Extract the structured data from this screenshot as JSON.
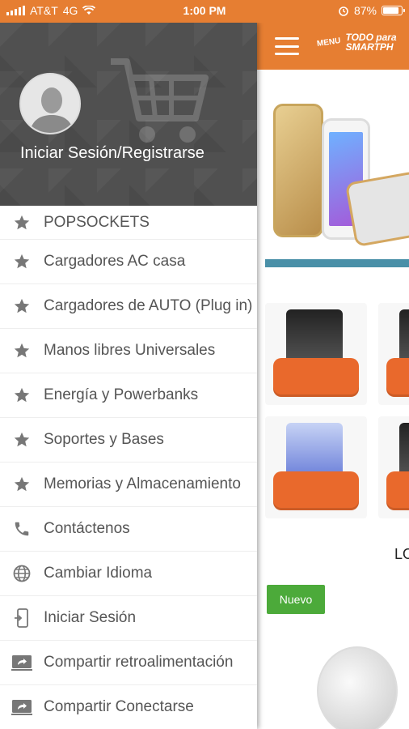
{
  "status_bar": {
    "carrier": "AT&T",
    "network": "4G",
    "time": "1:00 PM",
    "battery": "87%"
  },
  "drawer": {
    "header": {
      "login_label": "Iniciar Sesión/Registrarse"
    },
    "items": [
      {
        "label": "POPSOCKETS",
        "icon": "star-icon"
      },
      {
        "label": "Cargadores AC casa",
        "icon": "star-icon"
      },
      {
        "label": "Cargadores de AUTO (Plug in)",
        "icon": "star-icon"
      },
      {
        "label": "Manos libres Universales",
        "icon": "star-icon"
      },
      {
        "label": "Energía y Powerbanks",
        "icon": "star-icon"
      },
      {
        "label": "Soportes y Bases",
        "icon": "star-icon"
      },
      {
        "label": "Memorias y Almacenamiento",
        "icon": "star-icon"
      },
      {
        "label": "Contáctenos",
        "icon": "phone-icon"
      },
      {
        "label": "Cambiar Idioma",
        "icon": "globe-icon"
      },
      {
        "label": "Iniciar Sesión",
        "icon": "mobile-login-icon"
      },
      {
        "label": "Compartir retroalimentación",
        "icon": "share-screen-icon"
      },
      {
        "label": "Compartir Conectarse",
        "icon": "share-screen-icon"
      }
    ]
  },
  "app": {
    "toolbar": {
      "menu_text": "MENU",
      "logo_line1": "TODO para",
      "logo_line2": "SMARTPH"
    },
    "section_partial_text": "LO",
    "badge_label": "Nuevo"
  },
  "colors": {
    "accent_orange": "#e67e32",
    "button_orange": "#e9692c",
    "badge_green": "#4caa3a",
    "drawer_header": "#505050"
  }
}
